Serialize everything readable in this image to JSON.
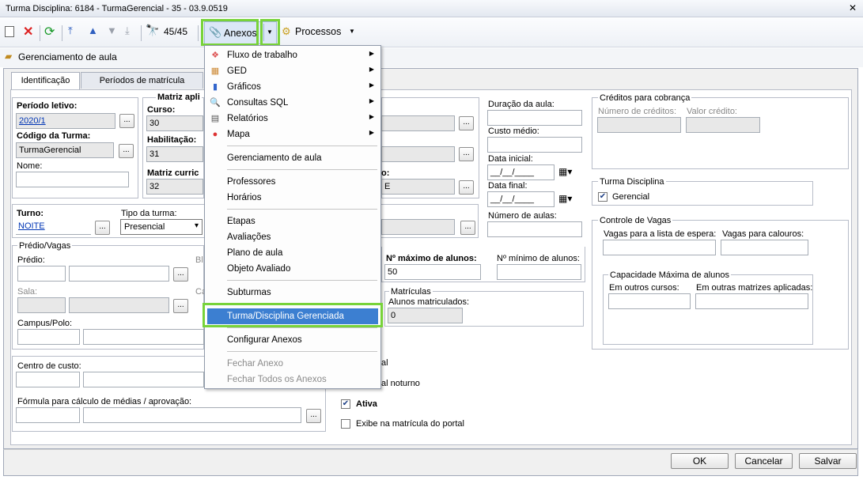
{
  "window": {
    "title": "Turma Disciplina: 6184 - TurmaGerencial - 35 - 03.9.0519",
    "close": "✕"
  },
  "toolbar": {
    "nav_count": "45/45",
    "anexos_label": "Anexos",
    "processos_label": "Processos"
  },
  "breadcrumb": "Gerenciamento de aula",
  "tabs": [
    "Identificação",
    "Períodos de matrícula"
  ],
  "form": {
    "periodo_letivo_label": "Período letivo:",
    "periodo_letivo_value": "2020/1",
    "codigo_turma_label": "Código da Turma:",
    "codigo_turma_value": "TurmaGerencial",
    "nome_label": "Nome:",
    "matriz_label": "Matriz apli",
    "curso_label": "Curso:",
    "curso_value": "30",
    "habilitacao_label": "Habilitação:",
    "habilitacao_value": "31",
    "matriz_curric_label": "Matriz curric",
    "matriz_curric_value": "32",
    "partial_o": "o:",
    "partial_e": "E",
    "turno_label": "Turno:",
    "turno_value": "NOITE",
    "tipo_turma_label": "Tipo da turma:",
    "tipo_turma_value": "Presencial",
    "predio_vagas_label": "Prédio/Vagas",
    "predio_label": "Prédio:",
    "bl_partial": "Bl",
    "sala_label": "Sala:",
    "ca_partial": "Ca",
    "campus_label": "Campus/Polo:",
    "centro_custo_label": "Centro de custo:",
    "formula_label": "Fórmula para cálculo de médias / aprovação:",
    "duracao_label": "Duração da aula:",
    "custo_medio_label": "Custo médio:",
    "data_inicial_label": "Data inicial:",
    "data_final_label": "Data final:",
    "date_mask": "__/__/____",
    "numero_aulas_label": "Número de aulas:",
    "max_alunos_label": "Nº máximo de alunos:",
    "max_alunos_value": "50",
    "min_alunos_label": "Nº mínimo de alunos:",
    "matriculas_label": "Matrículas",
    "alunos_matriculados_label": "Alunos matriculados:",
    "alunos_matriculados_value": "0",
    "al_partial": "al",
    "al_noturno_partial": "al noturno",
    "ativa_label": "Ativa",
    "exibe_portal_label": "Exibe na matrícula do portal",
    "creditos_label": "Créditos para cobrança",
    "num_creditos_label": "Número de créditos:",
    "valor_credito_label": "Valor crédito:",
    "turma_disciplina_group": "Turma Disciplina",
    "gerencial_label": "Gerencial",
    "controle_vagas_label": "Controle de Vagas",
    "vagas_espera_label": "Vagas para a lista de espera:",
    "vagas_calouros_label": "Vagas para calouros:",
    "capacidade_label": "Capacidade Máxima de alunos",
    "outros_cursos_label": "Em outros cursos:",
    "outras_matrizes_label": "Em outras matrizes aplicadas:",
    "ellipsis": "..."
  },
  "menu": {
    "items": [
      {
        "label": "Fluxo de trabalho",
        "icon": "workflow-icon"
      },
      {
        "label": "GED",
        "icon": "ged-icon"
      },
      {
        "label": "Gráficos",
        "icon": "chart-icon"
      },
      {
        "label": "Consultas SQL",
        "icon": "sql-query-icon"
      },
      {
        "label": "Relatórios",
        "icon": "report-icon"
      },
      {
        "label": "Mapa",
        "icon": "map-pin-icon"
      },
      {
        "label": "Gerenciamento de aula"
      },
      {
        "label": "Professores"
      },
      {
        "label": "Horários"
      },
      {
        "label": "Etapas"
      },
      {
        "label": "Avaliações"
      },
      {
        "label": "Plano de aula"
      },
      {
        "label": "Objeto Avaliado"
      },
      {
        "label": "Subturmas"
      },
      {
        "label": "Turma/Disciplina Gerenciada"
      },
      {
        "label": "Configurar Anexos"
      },
      {
        "label": "Fechar Anexo"
      },
      {
        "label": "Fechar Todos os Anexos"
      }
    ]
  },
  "buttons": {
    "ok": "OK",
    "cancel": "Cancelar",
    "save": "Salvar"
  },
  "colors": {
    "highlight": "#78d33a",
    "menu_selected": "#3c7fd1",
    "link": "#0036b5"
  }
}
